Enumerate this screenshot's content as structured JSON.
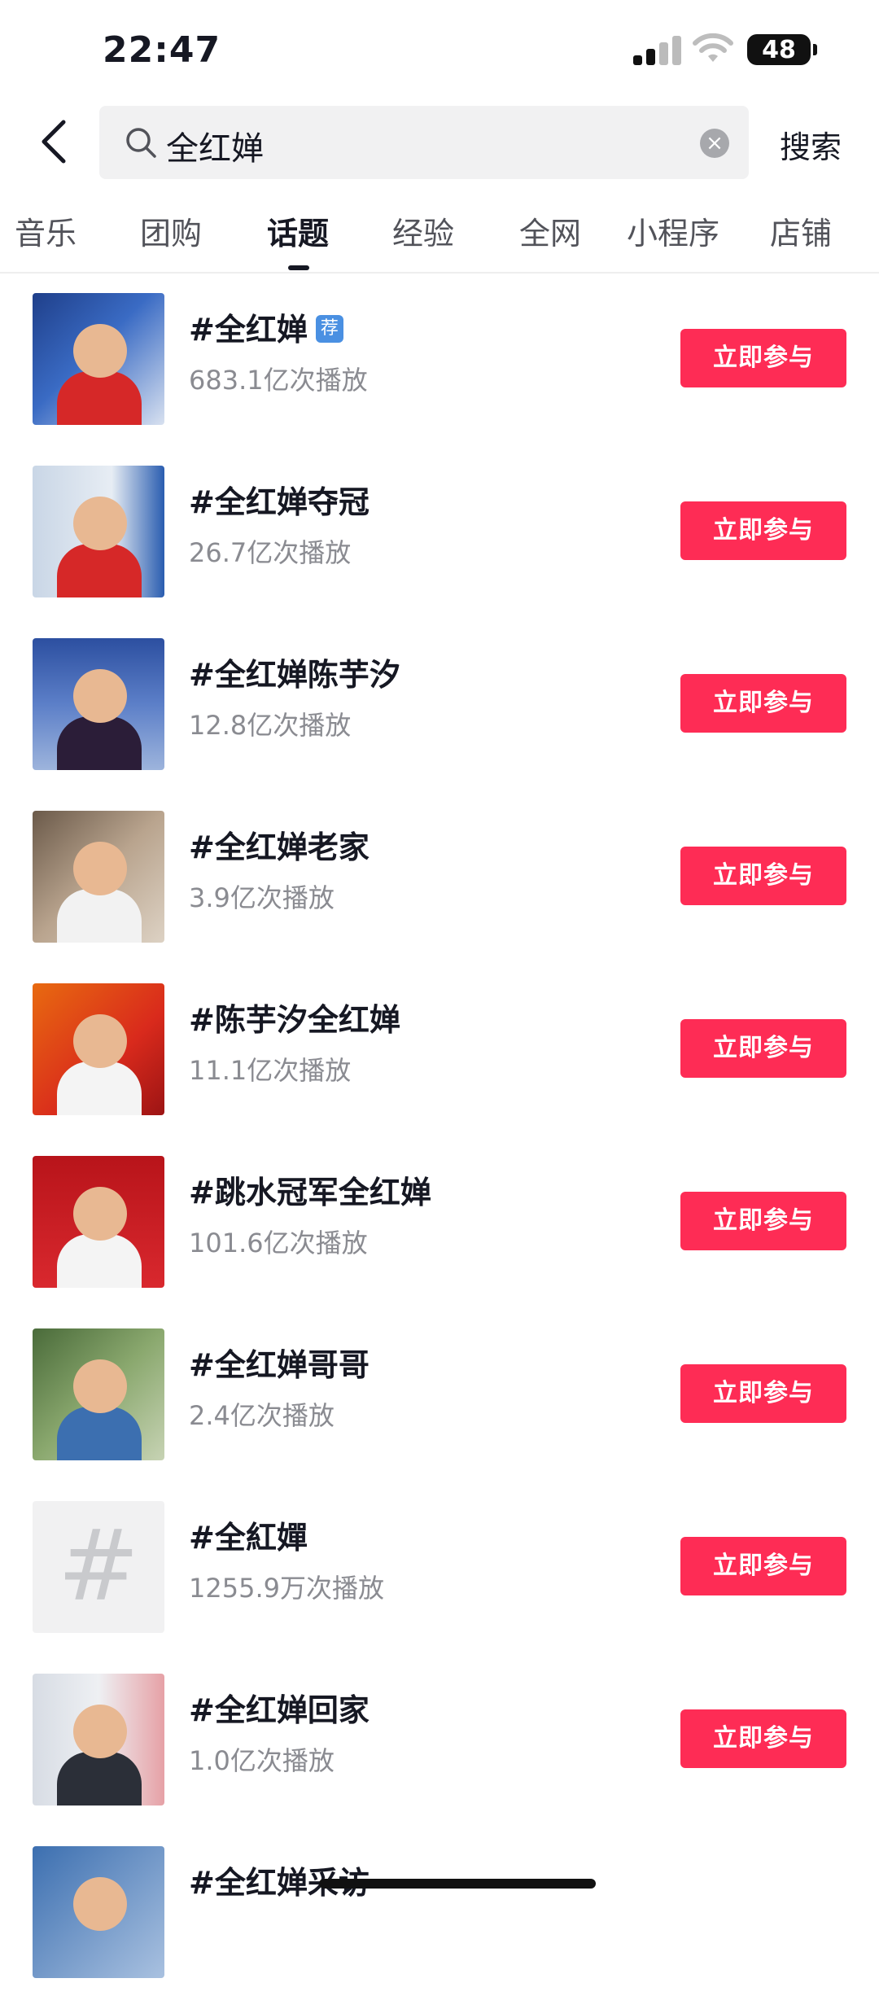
{
  "status_bar": {
    "time": "22:47",
    "battery": "48"
  },
  "search": {
    "query": "全红婵",
    "submit_label": "搜索",
    "clear_glyph": "×"
  },
  "tabs": [
    {
      "label": "音乐"
    },
    {
      "label": "团购"
    },
    {
      "label": "话题",
      "active": true
    },
    {
      "label": "经验"
    },
    {
      "label": "全网"
    },
    {
      "label": "小程序"
    },
    {
      "label": "店铺"
    }
  ],
  "topics": [
    {
      "title": "#全红婵",
      "badge": "荐",
      "plays": "683.1亿次播放",
      "join": "立即参与",
      "thumb": "photo"
    },
    {
      "title": "#全红婵夺冠",
      "plays": "26.7亿次播放",
      "join": "立即参与",
      "thumb": "photo"
    },
    {
      "title": "#全红婵陈芋汐",
      "plays": "12.8亿次播放",
      "join": "立即参与",
      "thumb": "photo"
    },
    {
      "title": "#全红婵老家",
      "plays": "3.9亿次播放",
      "join": "立即参与",
      "thumb": "photo"
    },
    {
      "title": "#陈芋汐全红婵",
      "plays": "11.1亿次播放",
      "join": "立即参与",
      "thumb": "photo"
    },
    {
      "title": "#跳水冠军全红婵",
      "plays": "101.6亿次播放",
      "join": "立即参与",
      "thumb": "photo"
    },
    {
      "title": "#全红婵哥哥",
      "plays": "2.4亿次播放",
      "join": "立即参与",
      "thumb": "photo"
    },
    {
      "title": "#全紅嬋",
      "plays": "1255.9万次播放",
      "join": "立即参与",
      "thumb": "hash-placeholder"
    },
    {
      "title": "#全红婵回家",
      "plays": "1.0亿次播放",
      "join": "立即参与",
      "thumb": "photo"
    },
    {
      "title": "#全红婵采访",
      "plays": "",
      "join": "",
      "thumb": "photo"
    }
  ],
  "icons": {
    "back": "chevron-left-icon",
    "search": "search-icon",
    "clear": "clear-icon",
    "hash": "hashtag-icon"
  },
  "colors": {
    "accent": "#fe2c55",
    "badge": "#4a90e2",
    "text": "#161823",
    "muted": "#8a8b91"
  }
}
